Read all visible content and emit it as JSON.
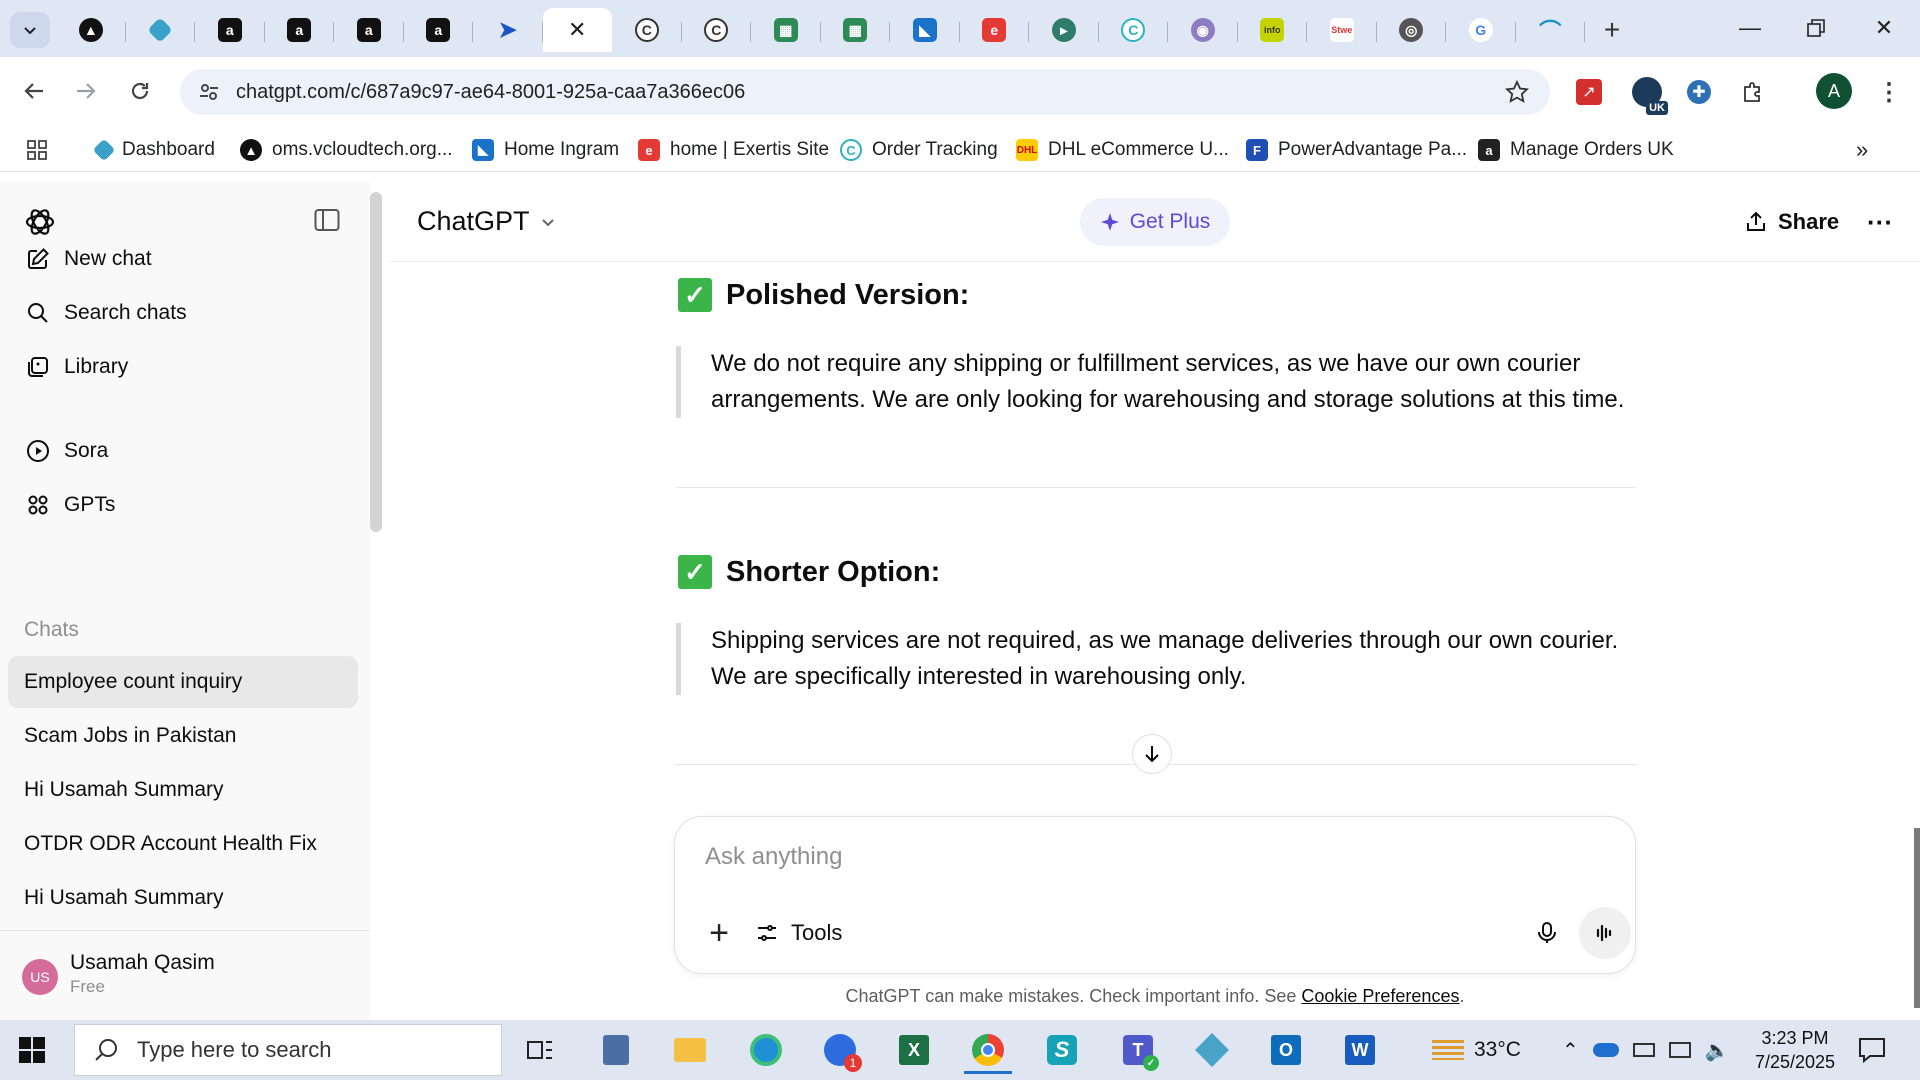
{
  "browser": {
    "url": "chatgpt.com/c/687a9c97-ae64-8001-925a-caa7a366ec06",
    "bookmarks": [
      {
        "label": "Dashboard",
        "color": "#3aa0c8"
      },
      {
        "label": "oms.vcloudtech.org...",
        "color": "#111111"
      },
      {
        "label": "Home Ingram",
        "color": "#1a73c8"
      },
      {
        "label": "home | Exertis Site",
        "color": "#e53935"
      },
      {
        "label": "Order Tracking",
        "color": "#2bb3c0"
      },
      {
        "label": "DHL eCommerce U...",
        "color": "#ffcc00"
      },
      {
        "label": "PowerAdvantage Pa...",
        "color": "#1f4fb5"
      },
      {
        "label": "Manage Orders UK",
        "color": "#222222"
      }
    ],
    "extension_badge": "UK",
    "profile_initial": "A"
  },
  "sidebar": {
    "nav": [
      {
        "label": "New chat",
        "icon": "new-chat-icon"
      },
      {
        "label": "Search chats",
        "icon": "search-icon"
      },
      {
        "label": "Library",
        "icon": "library-icon"
      },
      {
        "label": "Sora",
        "icon": "play-circle-icon"
      },
      {
        "label": "GPTs",
        "icon": "grid-icon"
      }
    ],
    "chats_heading": "Chats",
    "chats": [
      "Employee count inquiry",
      "Scam Jobs in Pakistan",
      "Hi Usamah Summary",
      "OTDR ODR Account Health Fix",
      "Hi Usamah Summary"
    ],
    "user": {
      "initials": "US",
      "name": "Usamah Qasim",
      "plan": "Free"
    }
  },
  "header": {
    "model": "ChatGPT",
    "get_plus": "Get Plus",
    "share": "Share"
  },
  "conversation": {
    "sections": [
      {
        "title": "Polished Version:",
        "text": "We do not require any shipping or fulfillment services, as we have our own courier arrangements. We are only looking for warehousing and storage solutions at this time."
      },
      {
        "title": "Shorter Option:",
        "text": "Shipping services are not required, as we manage deliveries through our own courier. We are specifically interested in warehousing only."
      }
    ]
  },
  "composer": {
    "placeholder": "Ask anything",
    "tools_label": "Tools"
  },
  "disclaimer": {
    "text": "ChatGPT can make mistakes. Check important info. See ",
    "link": "Cookie Preferences",
    "end": "."
  },
  "taskbar": {
    "search_placeholder": "Type here to search",
    "temperature": "33°C",
    "time": "3:23 PM",
    "date": "7/25/2025",
    "zoom_badge": "1"
  }
}
